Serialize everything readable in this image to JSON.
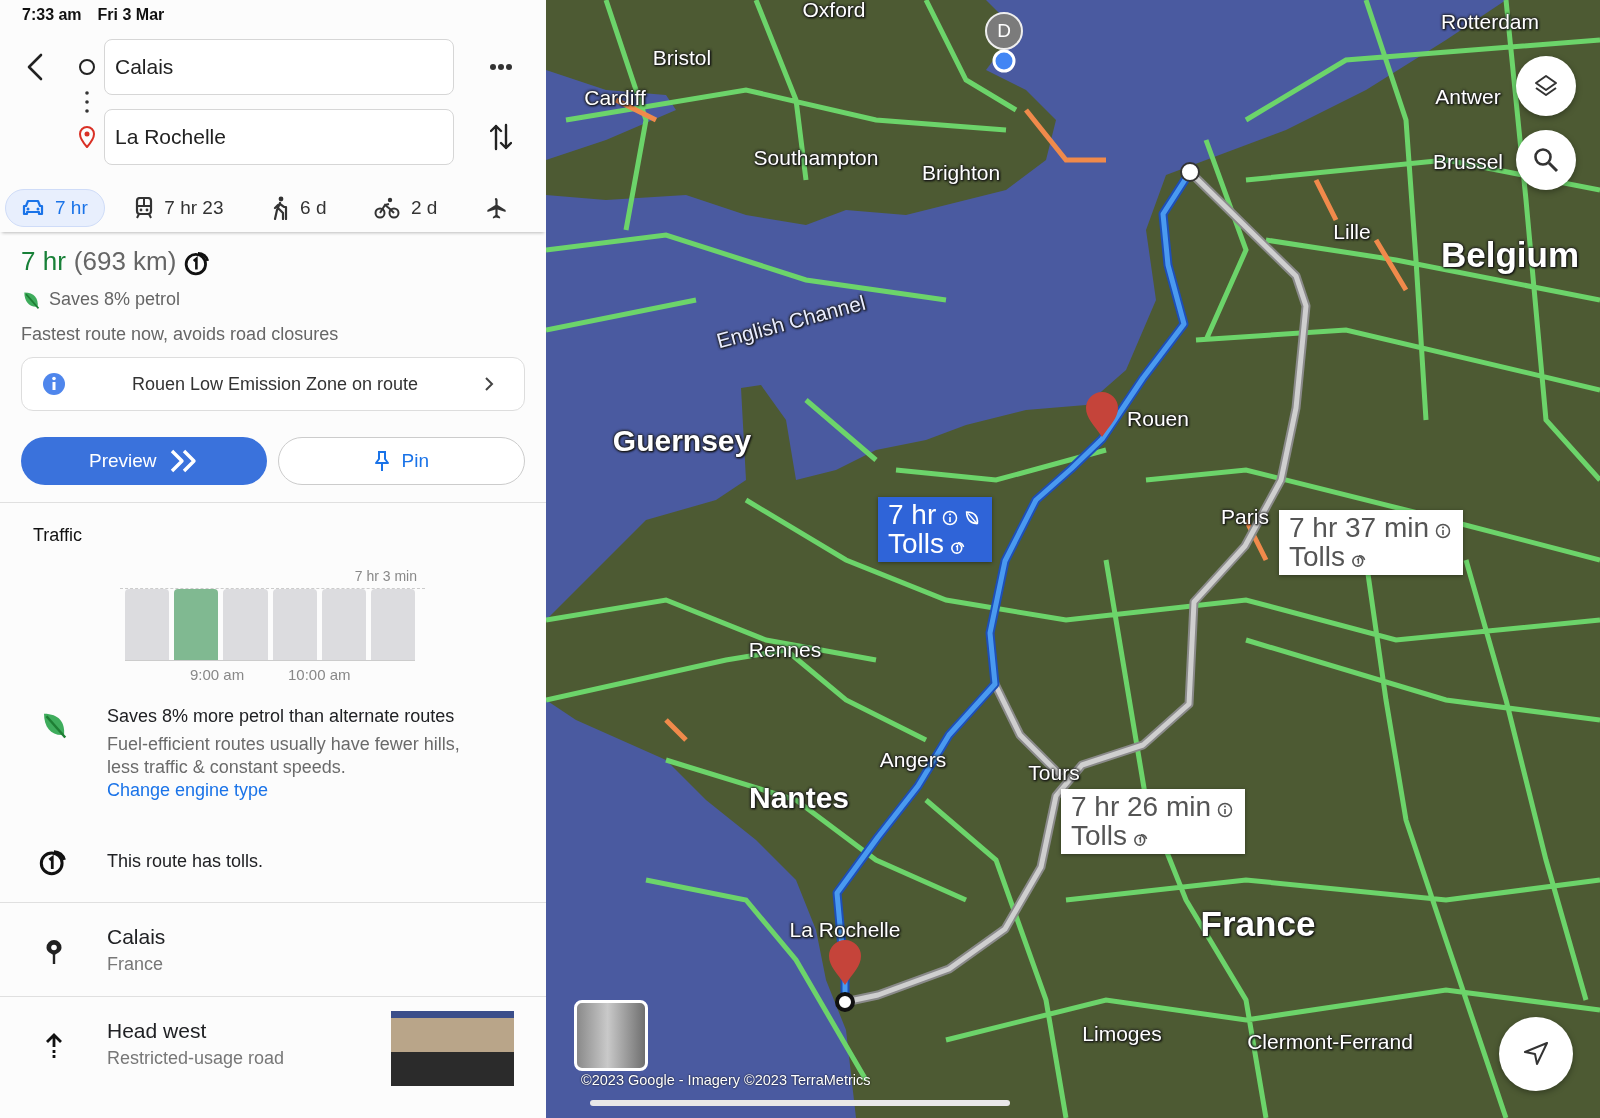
{
  "status_bar": {
    "time": "7:33 am",
    "date": "Fri 3 Mar"
  },
  "directions": {
    "origin": {
      "value": "Calais"
    },
    "destination": {
      "value": "La Rochelle"
    }
  },
  "modes": [
    {
      "kind": "car",
      "label": "7 hr",
      "selected": true
    },
    {
      "kind": "transit",
      "label": "7 hr 23",
      "selected": false
    },
    {
      "kind": "walk",
      "label": "6 d",
      "selected": false
    },
    {
      "kind": "bike",
      "label": "2 d",
      "selected": false
    },
    {
      "kind": "flight",
      "selected": false
    }
  ],
  "summary": {
    "duration": "7 hr",
    "distance": "(693 km)",
    "has_tolls": true,
    "eco_note": "Saves 8% petrol",
    "description": "Fastest route now, avoids road closures"
  },
  "notice": {
    "text": "Rouen Low Emission Zone on route"
  },
  "buttons": [
    {
      "kind": "primary",
      "label": "Preview"
    },
    {
      "kind": "secondary",
      "label": "Pin"
    }
  ],
  "traffic": {
    "title": "Traffic",
    "reference": "7 hr 3 min",
    "time_labels": [
      "9:00 am",
      "10:00 am"
    ],
    "bars": [
      {
        "selected": false
      },
      {
        "selected": true
      },
      {
        "selected": false
      },
      {
        "selected": false
      },
      {
        "selected": false
      },
      {
        "selected": false
      }
    ]
  },
  "details": [
    {
      "kind": "eco",
      "title": "Saves 8% more petrol than alternate routes",
      "body": "Fuel-efficient routes usually have fewer hills, less traffic & constant speeds.",
      "link": "Change engine type"
    },
    {
      "kind": "tolls",
      "title": "This route has tolls."
    }
  ],
  "steps": [
    {
      "kind": "place",
      "title": "Calais",
      "subtitle": "France",
      "has_photo": false
    },
    {
      "kind": "head",
      "title": "Head west",
      "subtitle": "Restricted-usage road",
      "has_photo": true
    }
  ],
  "map": {
    "user_initial": "D",
    "places": [
      {
        "name": "Oxford",
        "kind": "city"
      },
      {
        "name": "Bristol",
        "kind": "city"
      },
      {
        "name": "Cardiff",
        "kind": "city"
      },
      {
        "name": "Southampton",
        "kind": "city"
      },
      {
        "name": "Brighton",
        "kind": "city"
      },
      {
        "name": "English Channel",
        "kind": "sea"
      },
      {
        "name": "Guernsey",
        "kind": "major"
      },
      {
        "name": "Rotterdam",
        "kind": "city"
      },
      {
        "name": "Antwer",
        "kind": "city"
      },
      {
        "name": "Brussel",
        "kind": "city"
      },
      {
        "name": "Lille",
        "kind": "city"
      },
      {
        "name": "Belgium",
        "kind": "country"
      },
      {
        "name": "Rouen",
        "kind": "city"
      },
      {
        "name": "Paris",
        "kind": "city"
      },
      {
        "name": "Rennes",
        "kind": "city"
      },
      {
        "name": "Angers",
        "kind": "city"
      },
      {
        "name": "Tours",
        "kind": "city"
      },
      {
        "name": "Nantes",
        "kind": "major"
      },
      {
        "name": "La Rochelle",
        "kind": "city"
      },
      {
        "name": "France",
        "kind": "country"
      },
      {
        "name": "Limoges",
        "kind": "city"
      },
      {
        "name": "Clermont-Ferrand",
        "kind": "city"
      }
    ],
    "routes": [
      {
        "duration": "7 hr",
        "tolls": "Tolls",
        "selected": true,
        "eco": true
      },
      {
        "duration": "7 hr 37 min",
        "tolls": "Tolls",
        "selected": false,
        "eco": false
      },
      {
        "duration": "7 hr 26 min",
        "tolls": "Tolls",
        "selected": false,
        "eco": false
      }
    ],
    "copyright": "©2023 Google - Imagery ©2023 TerraMetrics"
  }
}
